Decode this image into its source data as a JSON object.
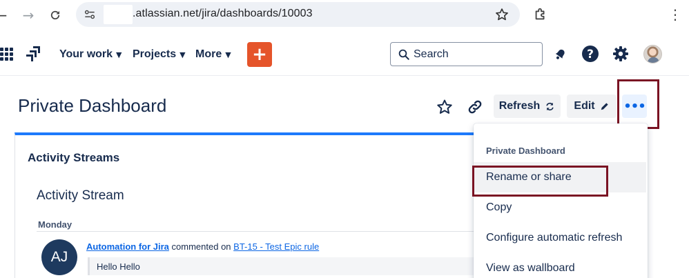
{
  "browser": {
    "url_text": ".atlassian.net/jira/dashboards/10003"
  },
  "nav": {
    "your_work": "Your work",
    "projects": "Projects",
    "more": "More",
    "create": "+",
    "search_placeholder": "Search"
  },
  "dashboard": {
    "title": "Private Dashboard",
    "refresh_label": "Refresh",
    "edit_label": "Edit",
    "more_label": "•••"
  },
  "gadget": {
    "title": "Activity Streams",
    "stream_title": "Activity Stream",
    "day": "Monday",
    "entry": {
      "avatar_initials": "AJ",
      "actor": "Automation for Jira",
      "verb": "commented on",
      "issue": "BT-15 - Test Epic rule",
      "comment": "Hello Hello"
    }
  },
  "menu": {
    "group_label": "Private Dashboard",
    "items": [
      "Rename or share",
      "Copy",
      "Configure automatic refresh",
      "View as wallboard"
    ]
  },
  "colors": {
    "highlight": "#7a1323",
    "accent": "#1d7afc",
    "create_button": "#e5542a"
  }
}
